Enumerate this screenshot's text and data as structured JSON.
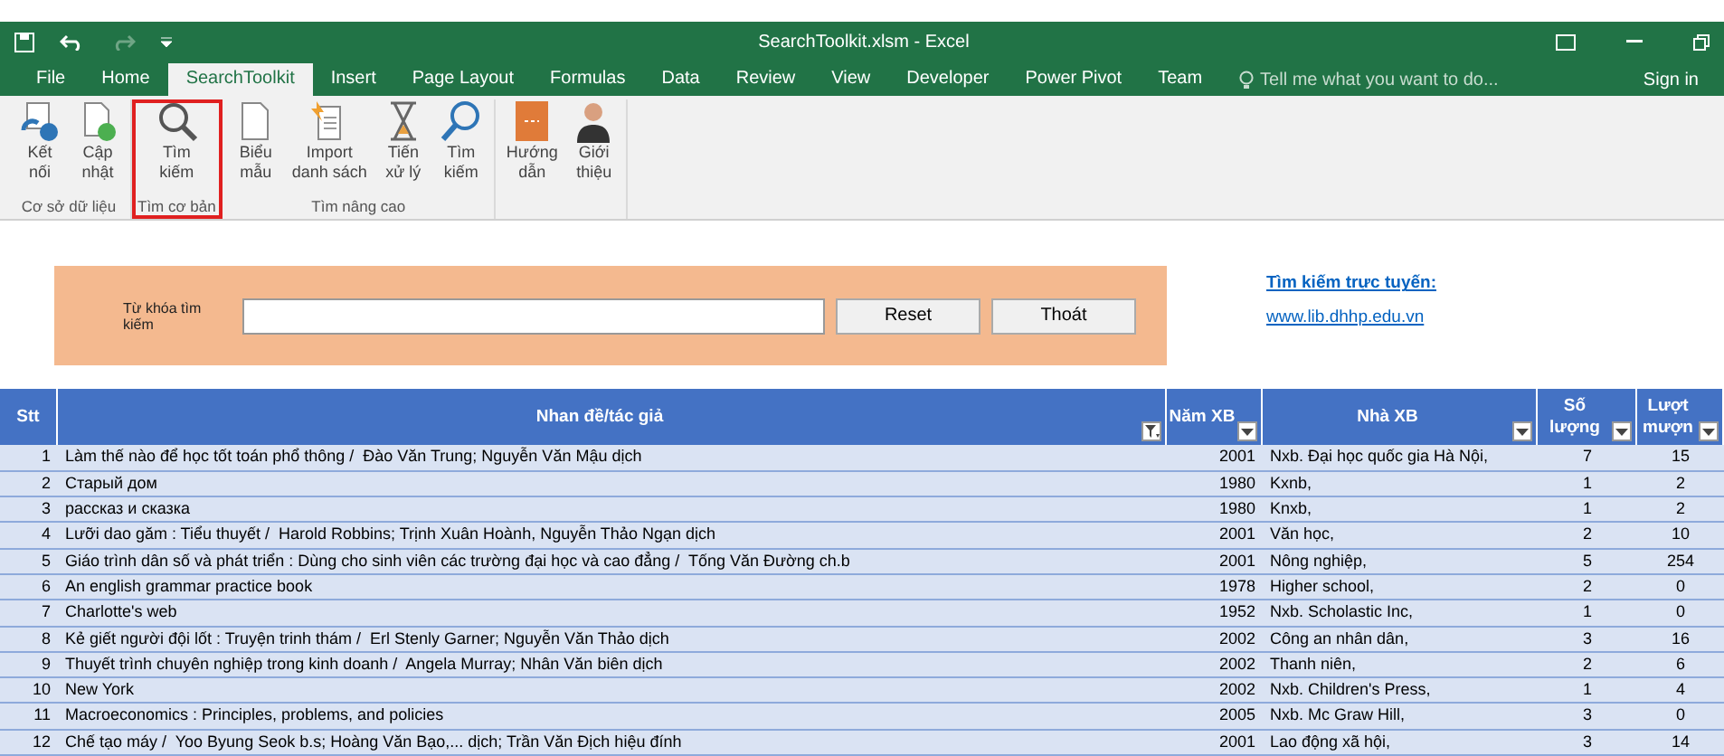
{
  "window": {
    "title": "SearchToolkit.xlsm - Excel",
    "sign_in": "Sign in",
    "tell_me": "Tell me what you want to do..."
  },
  "tabs": [
    {
      "label": "File",
      "selected": false
    },
    {
      "label": "Home",
      "selected": false
    },
    {
      "label": "SearchToolkit",
      "selected": true
    },
    {
      "label": "Insert",
      "selected": false
    },
    {
      "label": "Page Layout",
      "selected": false
    },
    {
      "label": "Formulas",
      "selected": false
    },
    {
      "label": "Data",
      "selected": false
    },
    {
      "label": "Review",
      "selected": false
    },
    {
      "label": "View",
      "selected": false
    },
    {
      "label": "Developer",
      "selected": false
    },
    {
      "label": "Power Pivot",
      "selected": false
    },
    {
      "label": "Team",
      "selected": false
    }
  ],
  "ribbon_groups": [
    {
      "label": "Cơ sở dữ liệu",
      "selected": false,
      "buttons": [
        {
          "kind": "connect",
          "lines": [
            "Kết",
            "nối"
          ]
        },
        {
          "kind": "refresh",
          "lines": [
            "Cập",
            "nhật"
          ]
        }
      ]
    },
    {
      "label": "Tìm cơ bản",
      "selected": true,
      "buttons": [
        {
          "kind": "search",
          "lines": [
            "Tìm",
            "kiếm"
          ]
        }
      ]
    },
    {
      "label": "Tìm nâng cao",
      "selected": false,
      "buttons": [
        {
          "kind": "page",
          "lines": [
            "Biểu",
            "mẫu"
          ]
        },
        {
          "kind": "import",
          "lines": [
            "Import",
            "danh sách"
          ]
        },
        {
          "kind": "hourglass",
          "lines": [
            "Tiến",
            "xử lý"
          ]
        },
        {
          "kind": "search-blue",
          "lines": [
            "Tìm",
            "kiếm"
          ]
        }
      ]
    },
    {
      "buttons": [
        {
          "kind": "book",
          "lines": [
            "Hướng",
            "dẫn"
          ]
        },
        {
          "kind": "person",
          "lines": [
            "Giới",
            "thiệu"
          ]
        }
      ]
    }
  ],
  "search_form": {
    "label": "Từ khóa tìm kiếm",
    "buttons": [
      "Reset",
      "Thoát"
    ]
  },
  "online": {
    "heading": "Tìm kiếm trực tuyến:",
    "link": "www.lib.dhhp.edu.vn"
  },
  "table": {
    "columns": [
      {
        "lines": [
          "Stt"
        ],
        "kind": "plain"
      },
      {
        "lines": [
          "Nhan đề/tác giả"
        ],
        "kind": "filtered"
      },
      {
        "lines": [
          "Năm XB"
        ],
        "kind": "dropdown"
      },
      {
        "lines": [
          "Nhà XB"
        ],
        "kind": "dropdown"
      },
      {
        "lines": [
          "Số",
          "lượng"
        ],
        "kind": "dropdown"
      },
      {
        "lines": [
          "Lượt",
          "mượn"
        ],
        "kind": "dropdown"
      }
    ],
    "rows": [
      [
        "1",
        "Làm thế nào để học tốt toán phổ thông /  Đào Văn Trung; Nguyễn Văn Mậu dịch",
        "2001",
        "Nxb. Đại học quốc gia Hà Nội,",
        "7",
        "15"
      ],
      [
        "2",
        "Старый дом",
        "1980",
        "Kxnb,",
        "1",
        "2"
      ],
      [
        "3",
        "рассказ и сказка",
        "1980",
        "Knxb,",
        "1",
        "2"
      ],
      [
        "4",
        "Lưỡi dao găm : Tiểu thuyết /  Harold Robbins; Trịnh Xuân Hoành, Nguyễn Thảo Ngạn dịch",
        "2001",
        "Văn học,",
        "2",
        "10"
      ],
      [
        "5",
        "Giáo trình dân số và phát triển : Dùng cho sinh viên các trường đại học và cao đẳng /  Tống Văn Đường ch.b",
        "2001",
        "Nông nghiệp,",
        "5",
        "254"
      ],
      [
        "6",
        "An english grammar practice book",
        "1978",
        "Higher school,",
        "2",
        "0"
      ],
      [
        "7",
        "Charlotte's web",
        "1952",
        "Nxb. Scholastic Inc,",
        "1",
        "0"
      ],
      [
        "8",
        "Kẻ giết người đội lốt : Truyện trinh thám /  Erl Stenly Garner; Nguyễn Văn Thảo dịch",
        "2002",
        "Công an nhân dân,",
        "3",
        "16"
      ],
      [
        "9",
        "Thuyết trình chuyên nghiệp trong kinh doanh /  Angela Murray; Nhân Văn biên dịch",
        "2002",
        "Thanh niên,",
        "2",
        "6"
      ],
      [
        "10",
        "New York",
        "2002",
        "Nxb. Children's Press,",
        "1",
        "4"
      ],
      [
        "11",
        "Macroeconomics : Principles, problems, and policies",
        "2005",
        "Nxb. Mc Graw Hill,",
        "3",
        "0"
      ],
      [
        "12",
        "Chế tạo máy /  Yoo Byung Seok b.s; Hoàng Văn Bạo,... dịch; Trần Văn Địch hiệu đính",
        "2001",
        "Lao động xã hội,",
        "3",
        "14"
      ]
    ]
  }
}
